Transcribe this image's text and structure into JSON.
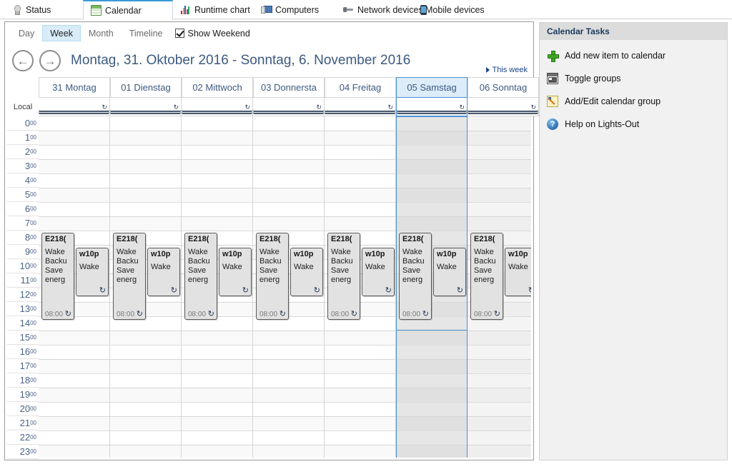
{
  "tabs": [
    {
      "label": "Status",
      "icon": "lightbulb-icon",
      "active": false
    },
    {
      "label": "Calendar",
      "icon": "calendar-icon",
      "active": true
    },
    {
      "label": "Runtime chart",
      "icon": "bar-chart-icon",
      "active": false
    },
    {
      "label": "Computers",
      "icon": "computer-icon",
      "active": false
    },
    {
      "label": "Network devices",
      "icon": "network-device-icon",
      "active": false
    },
    {
      "label": "Mobile devices",
      "icon": "mobile-device-icon",
      "active": false
    }
  ],
  "viewbar": {
    "buttons": [
      {
        "label": "Day",
        "selected": false
      },
      {
        "label": "Week",
        "selected": true
      },
      {
        "label": "Month",
        "selected": false
      },
      {
        "label": "Timeline",
        "selected": false
      }
    ],
    "show_weekend_label": "Show Weekend",
    "show_weekend_checked": true
  },
  "nav": {
    "prev_icon": "arrow-left-icon",
    "next_icon": "arrow-right-icon",
    "date_range": "Montag, 31. Oktober 2016 - Sonntag, 6. November 2016",
    "this_week_label": "This week"
  },
  "grid": {
    "timezone_label": "Local",
    "days": [
      {
        "label": "31 Montag",
        "selected": false,
        "weekend": false
      },
      {
        "label": "01 Dienstag",
        "selected": false,
        "weekend": false
      },
      {
        "label": "02 Mittwoch",
        "selected": false,
        "weekend": false
      },
      {
        "label": "03 Donnersta",
        "selected": false,
        "weekend": false
      },
      {
        "label": "04 Freitag",
        "selected": false,
        "weekend": false
      },
      {
        "label": "05 Samstag",
        "selected": true,
        "weekend": true
      },
      {
        "label": "06 Sonntag",
        "selected": false,
        "weekend": true
      }
    ],
    "hours": [
      {
        "hour": "0",
        "minutes": "00"
      },
      {
        "hour": "1",
        "minutes": "00"
      },
      {
        "hour": "2",
        "minutes": "00"
      },
      {
        "hour": "3",
        "minutes": "00"
      },
      {
        "hour": "4",
        "minutes": "00"
      },
      {
        "hour": "5",
        "minutes": "00"
      },
      {
        "hour": "6",
        "minutes": "00"
      },
      {
        "hour": "7",
        "minutes": "00"
      },
      {
        "hour": "8",
        "minutes": "00"
      },
      {
        "hour": "9",
        "minutes": "00"
      },
      {
        "hour": "10",
        "minutes": "00"
      },
      {
        "hour": "11",
        "minutes": "00"
      },
      {
        "hour": "12",
        "minutes": "00"
      },
      {
        "hour": "13",
        "minutes": "00"
      },
      {
        "hour": "14",
        "minutes": "00"
      },
      {
        "hour": "15",
        "minutes": "00"
      },
      {
        "hour": "16",
        "minutes": "00"
      },
      {
        "hour": "17",
        "minutes": "00"
      },
      {
        "hour": "18",
        "minutes": "00"
      },
      {
        "hour": "19",
        "minutes": "00"
      },
      {
        "hour": "20",
        "minutes": "00"
      },
      {
        "hour": "21",
        "minutes": "00"
      },
      {
        "hour": "22",
        "minutes": "00"
      },
      {
        "hour": "23",
        "minutes": "00"
      }
    ],
    "allday_recurrence_icon": "recurrence-icon"
  },
  "events": [
    {
      "day": 0,
      "lane": 0,
      "title": "E218(",
      "body": "Wake\nBacku\nSave\nenerg",
      "time": "08:00",
      "recurrence_icon": "recurrence-icon"
    },
    {
      "day": 0,
      "lane": 1,
      "title": "w10p",
      "body": "Wake",
      "time": "",
      "recurrence_icon": "recurrence-icon"
    },
    {
      "day": 1,
      "lane": 0,
      "title": "E218(",
      "body": "Wake\nBacku\nSave\nenerg",
      "time": "08:00",
      "recurrence_icon": "recurrence-icon"
    },
    {
      "day": 1,
      "lane": 1,
      "title": "w10p",
      "body": "Wake",
      "time": "",
      "recurrence_icon": "recurrence-icon"
    },
    {
      "day": 2,
      "lane": 0,
      "title": "E218(",
      "body": "Wake\nBacku\nSave\nenerg",
      "time": "08:00",
      "recurrence_icon": "recurrence-icon"
    },
    {
      "day": 2,
      "lane": 1,
      "title": "w10p",
      "body": "Wake",
      "time": "",
      "recurrence_icon": "recurrence-icon"
    },
    {
      "day": 3,
      "lane": 0,
      "title": "E218(",
      "body": "Wake\nBacku\nSave\nenerg",
      "time": "08:00",
      "recurrence_icon": "recurrence-icon"
    },
    {
      "day": 3,
      "lane": 1,
      "title": "w10p",
      "body": "Wake",
      "time": "",
      "recurrence_icon": "recurrence-icon"
    },
    {
      "day": 4,
      "lane": 0,
      "title": "E218(",
      "body": "Wake\nBacku\nSave\nenerg",
      "time": "08:00",
      "recurrence_icon": "recurrence-icon"
    },
    {
      "day": 4,
      "lane": 1,
      "title": "w10p",
      "body": "Wake",
      "time": "",
      "recurrence_icon": "recurrence-icon"
    },
    {
      "day": 5,
      "lane": 0,
      "title": "E218(",
      "body": "Wake\nBacku\nSave\nenerg",
      "time": "08:00",
      "recurrence_icon": "recurrence-icon"
    },
    {
      "day": 5,
      "lane": 1,
      "title": "w10p",
      "body": "Wake",
      "time": "",
      "recurrence_icon": "recurrence-icon"
    },
    {
      "day": 6,
      "lane": 0,
      "title": "E218(",
      "body": "Wake\nBacku\nSave\nenerg",
      "time": "08:00",
      "recurrence_icon": "recurrence-icon"
    },
    {
      "day": 6,
      "lane": 1,
      "title": "w10p",
      "body": "Wake",
      "time": "",
      "recurrence_icon": "recurrence-icon"
    }
  ],
  "task_panel": {
    "header": "Calendar Tasks",
    "items": [
      {
        "label": "Add new item to calendar",
        "icon": "plus-icon"
      },
      {
        "label": "Toggle groups",
        "icon": "grid-icon"
      },
      {
        "label": "Add/Edit calendar group",
        "icon": "edit-icon"
      },
      {
        "label": "Help on Lights-Out",
        "icon": "help-icon"
      }
    ]
  },
  "colors": {
    "accent": "#3b9ad9",
    "header_text": "#3c5a80",
    "selection": "#4a90d0",
    "task_header_bg": "#dcdcdc"
  }
}
